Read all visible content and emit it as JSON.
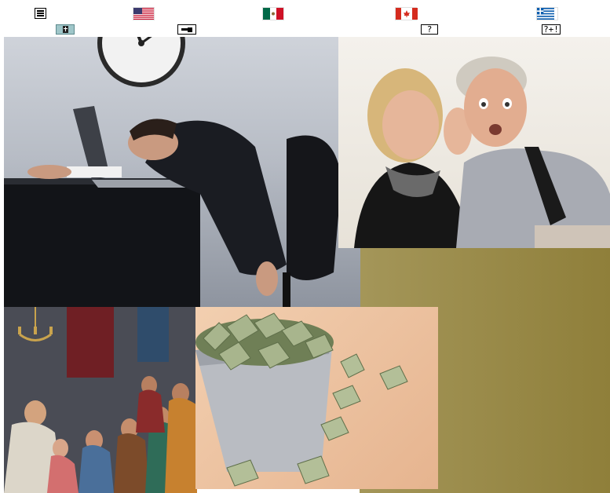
{
  "toolbar": {
    "menu_icon": "hamburger-menu-icon",
    "flags": [
      {
        "name": "us-flag-icon"
      },
      {
        "name": "mexico-flag-icon"
      },
      {
        "name": "canada-flag-icon"
      },
      {
        "name": "greece-flag-icon"
      }
    ],
    "row2": {
      "book_icon": "bible-book-icon",
      "pointer_icon": "pointing-hand-icon",
      "help_label": "?",
      "help_plus_label": "?+!"
    }
  },
  "collage": {
    "images": [
      {
        "name": "tired-businessman-photo"
      },
      {
        "name": "whispering-couple-photo"
      },
      {
        "name": "biblical-scene-painting"
      },
      {
        "name": "money-bucket-photo"
      }
    ]
  },
  "colors": {
    "olive_gradient_start": "#a49659",
    "olive_gradient_end": "#8f7f3a"
  }
}
